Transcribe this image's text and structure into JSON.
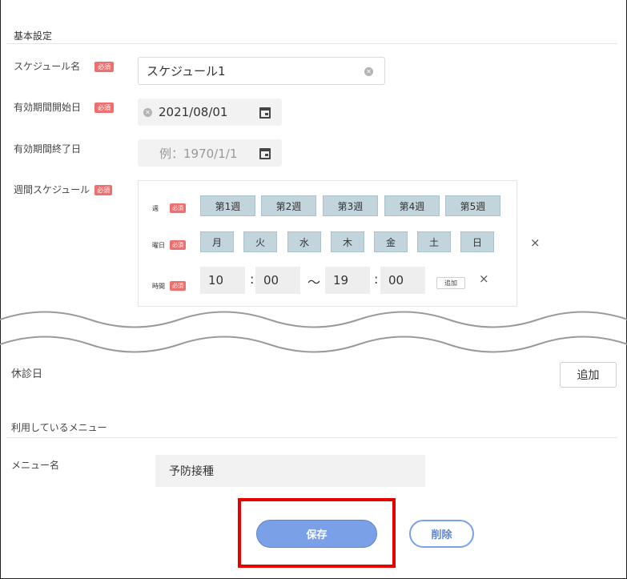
{
  "basic": {
    "section_title": "基本設定",
    "required_badge": "必須",
    "schedule_name_label": "スケジュール名",
    "schedule_name_value": "スケジュール1",
    "start_date_label": "有効期間開始日",
    "start_date_value": "2021/08/01",
    "end_date_label": "有効期間終了日",
    "end_date_placeholder": "例：1970/1/1",
    "weekly_label": "週間スケジュール"
  },
  "weekly": {
    "week_label": "週",
    "weeks": [
      "第1週",
      "第2週",
      "第3週",
      "第4週",
      "第5週"
    ],
    "day_label": "曜日",
    "days": [
      "月",
      "火",
      "水",
      "木",
      "金",
      "土",
      "日"
    ],
    "time_label": "時間",
    "start_hour": "10",
    "start_min": "00",
    "end_hour": "19",
    "end_min": "00",
    "colon": ":",
    "tilde": "～",
    "add_small_label": "追加",
    "remove_glyph": "×"
  },
  "holiday": {
    "label": "休診日",
    "add_label": "追加"
  },
  "menu": {
    "section_title": "利用しているメニュー",
    "menu_name_label": "メニュー名",
    "menu_name_value": "予防接種"
  },
  "actions": {
    "save_label": "保存",
    "delete_label": "削除"
  },
  "colors": {
    "required": "#ef6f6f",
    "chip": "#c2d5dc",
    "primary": "#7aa0e8",
    "highlight": "#e60000"
  }
}
